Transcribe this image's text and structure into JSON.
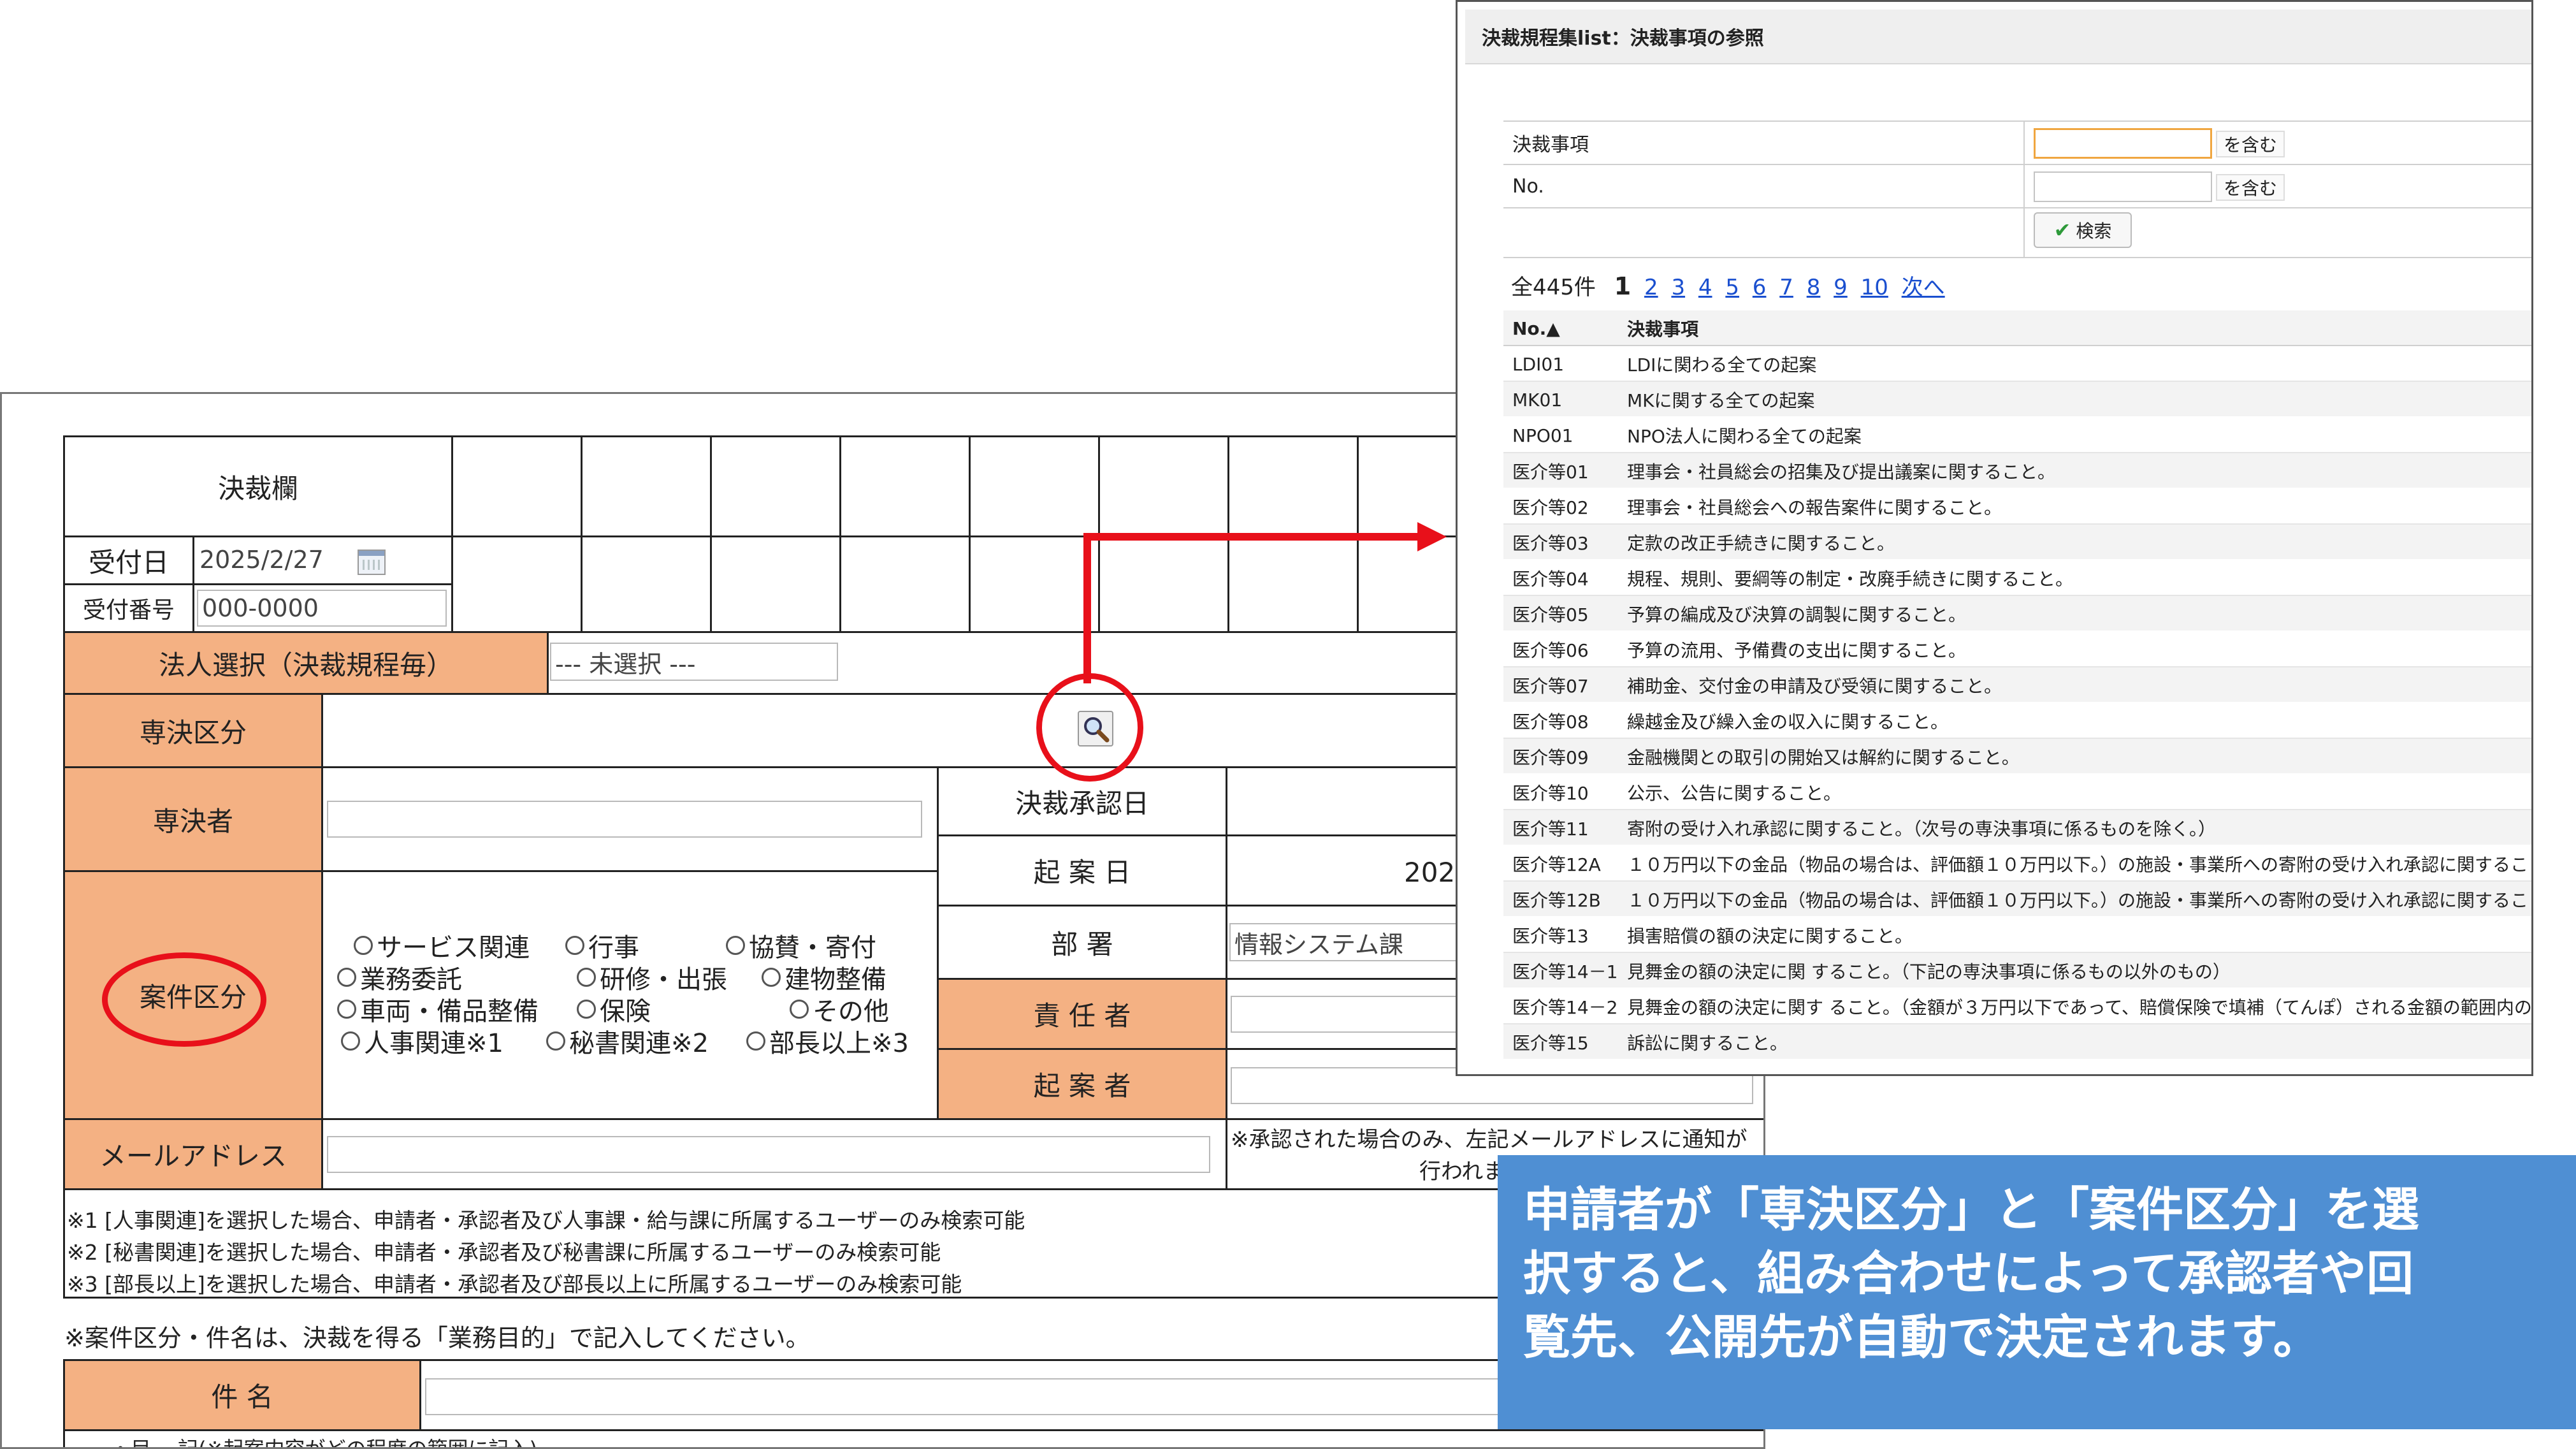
{
  "form": {
    "kessai_label": "決裁欄",
    "uketsuke_date_label": "受付日",
    "uketsuke_date_value": "2025/2/27",
    "uketsuke_no_label": "受付番号",
    "uketsuke_no_value": "000-0000",
    "houjin_label": "法人選択（決裁規程毎）",
    "houjin_value": "--- 未選択 ---",
    "senketsu_kubun_label": "専決区分",
    "senketsusha_label": "専決者",
    "kessai_shounin_label": "決裁承認日",
    "kian_date_label": "起 案 日",
    "kian_date_value": "202",
    "busho_label": "部 署",
    "busho_value": "情報システム課",
    "sekinin_label": "責 任 者",
    "kiansha_label": "起 案 者",
    "anken_kubun_label": "案件区分",
    "radio_options": [
      "サービス関連",
      "行事",
      "協賛・寄付",
      "業務委託",
      "研修・出張",
      "建物整備",
      "車両・備品整備",
      "保険",
      "その他",
      "人事関連※1",
      "秘書関連※2",
      "部長以上※3"
    ],
    "mail_label": "メールアドレス",
    "mail_note_1": "※承認された場合のみ、左記メールアドレスに通知が",
    "mail_note_2": "行われま",
    "notes": [
      "※1 [人事関連]を選択した場合、申請者・承認者及び人事課・給与課に所属するユーザーのみ検索可能",
      "※2 [秘書関連]を選択した場合、申請者・承認者及び秘書課に所属するユーザーのみ検索可能",
      "※3 [部長以上]を選択した場合、申請者・承認者及び部長以上に所属するユーザーのみ検索可能"
    ],
    "instruction": "※案件区分・件名は、決裁を得る「業務目的」で記入してください。",
    "kenmei_label": "件 名",
    "bottom_cut": "・目… 記(※起案内容がどの程度の範囲に記入)"
  },
  "popup": {
    "title": "決裁規程集list：決裁事項の参照",
    "search": {
      "kessai_label": "決裁事項",
      "no_label": "No.",
      "contains": "を含む",
      "search_button": "検索"
    },
    "total": "全445件",
    "current_page": "1",
    "pages": [
      "2",
      "3",
      "4",
      "5",
      "6",
      "7",
      "8",
      "9",
      "10"
    ],
    "next": "次へ",
    "columns": [
      "No.▲",
      "決裁事項"
    ],
    "rows": [
      [
        "LDI01",
        "LDIに関わる全ての起案"
      ],
      [
        "MK01",
        "MKに関する全ての起案"
      ],
      [
        "NPO01",
        "NPO法人に関わる全ての起案"
      ],
      [
        "医介等01",
        "理事会・社員総会の招集及び提出議案に関すること。"
      ],
      [
        "医介等02",
        "理事会・社員総会への報告案件に関すること。"
      ],
      [
        "医介等03",
        "定款の改正手続きに関すること。"
      ],
      [
        "医介等04",
        "規程、規則、要綱等の制定・改廃手続きに関すること。"
      ],
      [
        "医介等05",
        "予算の編成及び決算の調製に関すること。"
      ],
      [
        "医介等06",
        "予算の流用、予備費の支出に関すること。"
      ],
      [
        "医介等07",
        "補助金、交付金の申請及び受領に関すること。"
      ],
      [
        "医介等08",
        "繰越金及び繰入金の収入に関すること。"
      ],
      [
        "医介等09",
        "金融機関との取引の開始又は解約に関すること。"
      ],
      [
        "医介等10",
        "公示、公告に関すること。"
      ],
      [
        "医介等11",
        "寄附の受け入れ承認に関すること。（次号の専決事項に係るものを除く。）"
      ],
      [
        "医介等12A",
        "１０万円以下の金品（物品の場合は、評価額１０万円以下。）の施設・事業所への寄附の受け入れ承認に関するこ"
      ],
      [
        "医介等12B",
        "１０万円以下の金品（物品の場合は、評価額１０万円以下。）の施設・事業所への寄附の受け入れ承認に関するこ"
      ],
      [
        "医介等13",
        "損害賠償の額の決定に関すること。"
      ],
      [
        "医介等14－1",
        "見舞金の額の決定に関 すること。（下記の専決事項に係るもの以外のもの）"
      ],
      [
        "医介等14－2",
        "見舞金の額の決定に関す ること。（金額が３万円以下であって、賠償保険で填補（てんぽ）される金額の範囲内の"
      ],
      [
        "医介等15",
        "訴訟に関すること。"
      ]
    ]
  },
  "note": {
    "line1": "申請者が「専決区分」と「案件区分」を選",
    "line2": "択すると、組み合わせによって承認者や回",
    "line3": "覧先、公開先が自動で決定されます。"
  },
  "colors": {
    "orange": "#f4b183",
    "red": "#e8101a",
    "blue": "#4f8fd3",
    "link": "#1a4fcf"
  }
}
